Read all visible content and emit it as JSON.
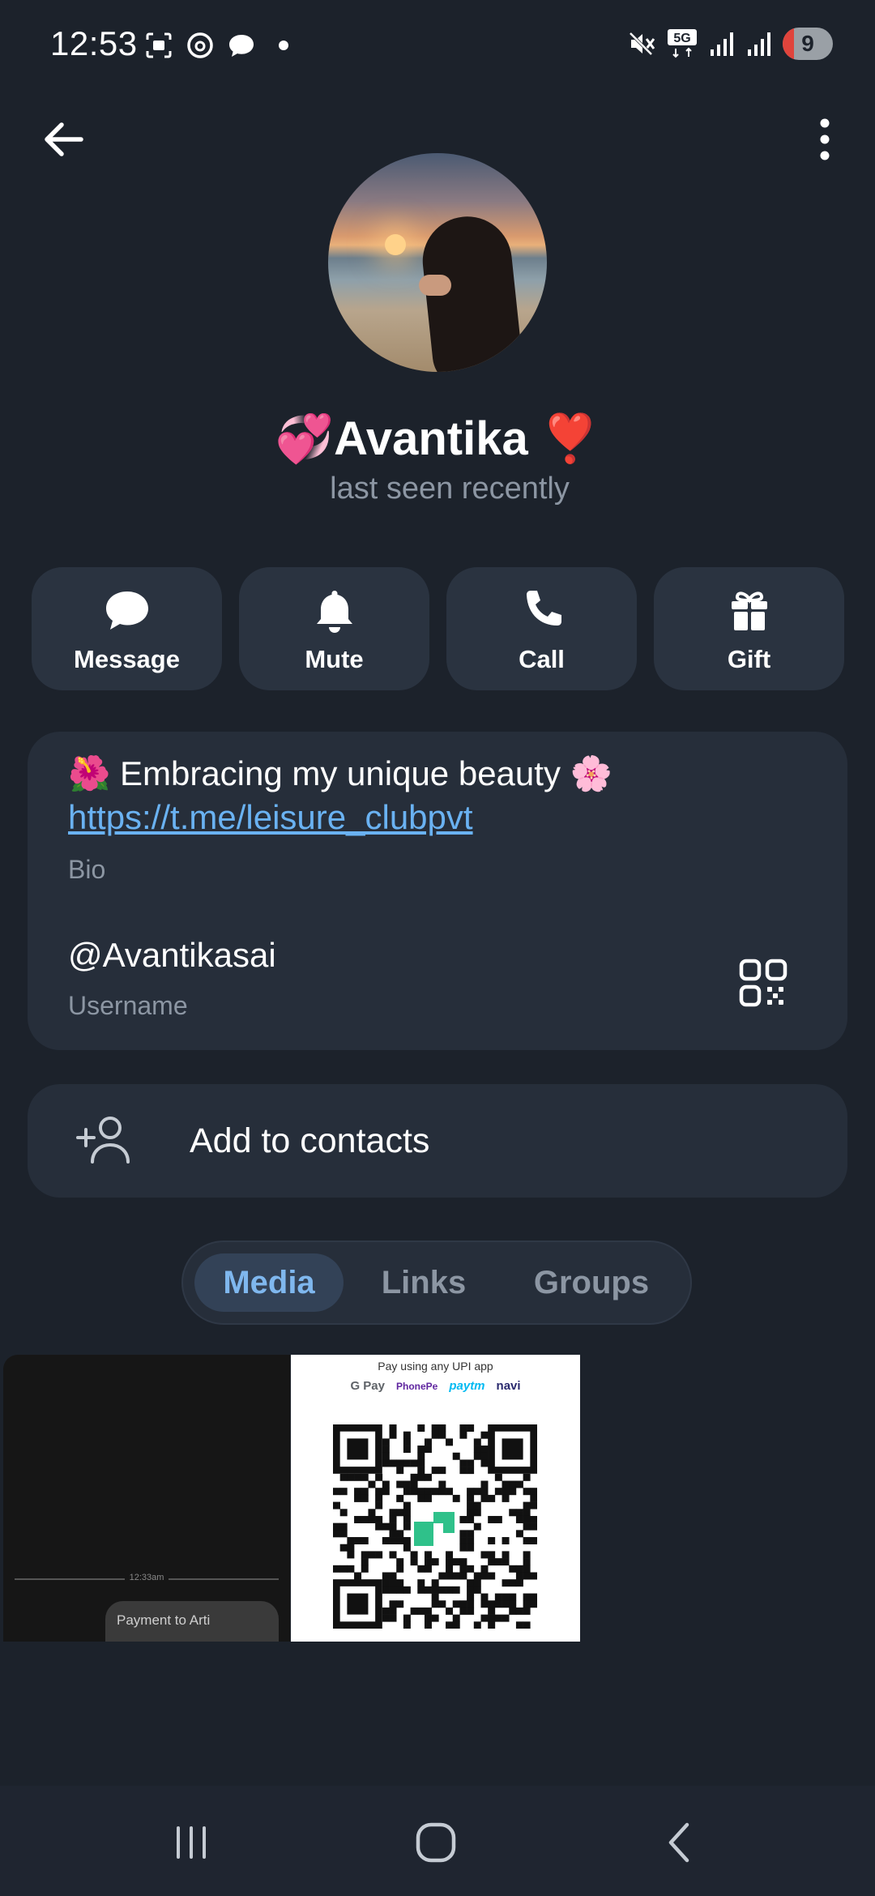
{
  "status_bar": {
    "time": "12:53",
    "battery": "9",
    "network": "5G"
  },
  "profile": {
    "name": "💞Avantika ❣️",
    "status": "last seen recently"
  },
  "actions": [
    {
      "label": "Message",
      "icon": "chat-bubble-icon"
    },
    {
      "label": "Mute",
      "icon": "bell-icon"
    },
    {
      "label": "Call",
      "icon": "phone-icon"
    },
    {
      "label": "Gift",
      "icon": "gift-icon"
    }
  ],
  "info": {
    "bio_text": "Embracing my unique beauty",
    "bio_emoji_start": "🌺",
    "bio_emoji_end": "🌸",
    "bio_link": "https://t.me/leisure_clubpvt",
    "bio_label": "Bio",
    "username": "@Avantikasai",
    "username_label": "Username"
  },
  "add_contact": {
    "label": "Add to contacts"
  },
  "tabs": [
    {
      "label": "Media",
      "active": true
    },
    {
      "label": "Links",
      "active": false
    },
    {
      "label": "Groups",
      "active": false
    }
  ],
  "media": {
    "item1_timestamp": "12:33am",
    "item1_text": "Payment to Arti",
    "item2_title": "Pay using any UPI app",
    "item2_apps": [
      "G Pay",
      "PhonePe",
      "paytm",
      "navi"
    ]
  },
  "colors": {
    "background": "#1c222b",
    "card": "#262e3a",
    "accent": "#6ab2f2",
    "secondary_text": "#8c96a3"
  }
}
